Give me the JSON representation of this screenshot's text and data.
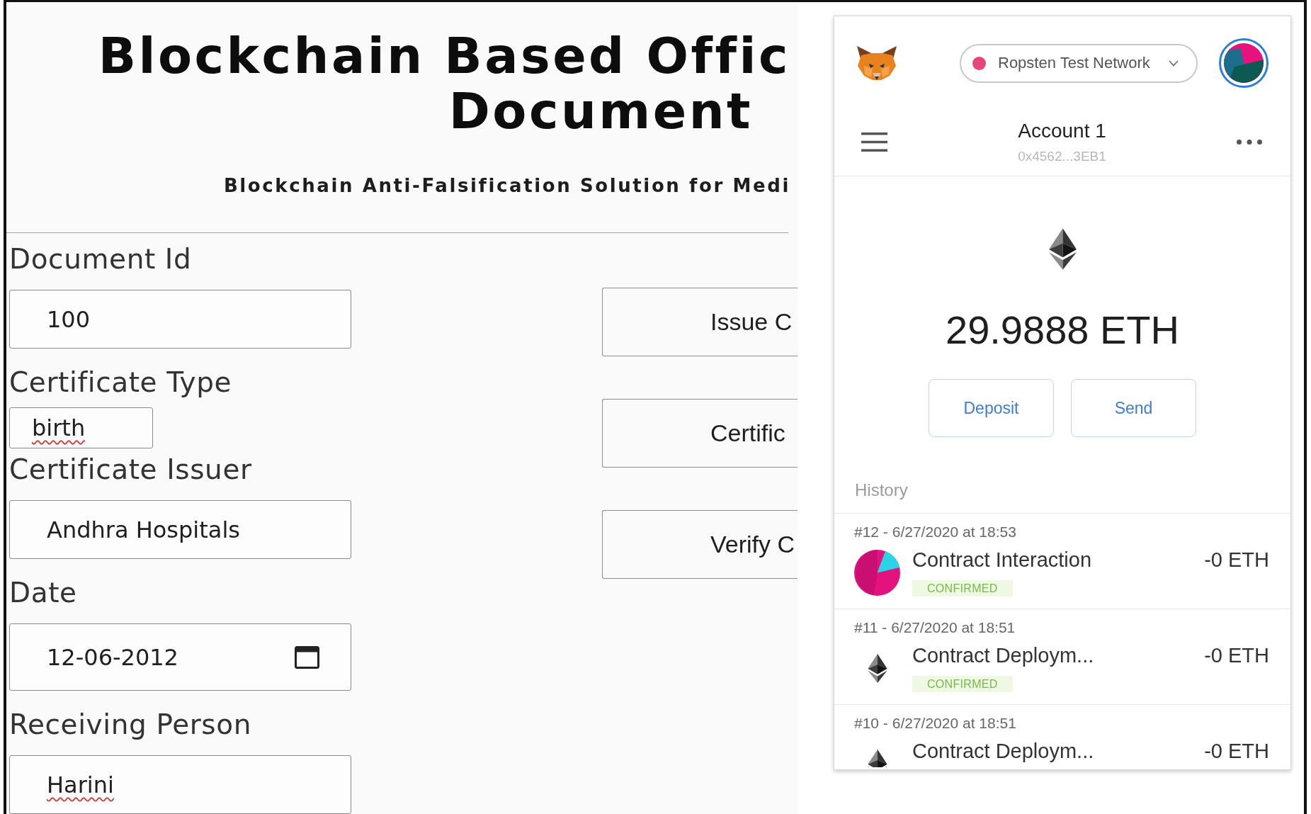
{
  "page": {
    "title_lines": [
      "Blockchain Based Offic",
      "Document"
    ],
    "subtitle": "Blockchain Anti-Falsification Solution for Medi"
  },
  "form": {
    "fields": [
      {
        "label": "Document Id",
        "value": "100",
        "kind": "text",
        "misspelled": false
      },
      {
        "label": "Certificate Type",
        "value": "birth",
        "kind": "short",
        "misspelled": true
      },
      {
        "label": "Certificate Issuer",
        "value": "Andhra Hospitals",
        "kind": "text",
        "misspelled": false
      },
      {
        "label": "Date",
        "value": "12-06-2012",
        "kind": "date",
        "misspelled": false
      },
      {
        "label": "Receiving Person",
        "value": "Harini",
        "kind": "text",
        "misspelled": true
      }
    ],
    "actions": [
      "Issue C",
      "Certific",
      "Verify C"
    ]
  },
  "wallet": {
    "network": "Ropsten Test Network",
    "account": {
      "name": "Account 1",
      "address": "0x4562...3EB1"
    },
    "balance": "29.9888 ETH",
    "actions": [
      "Deposit",
      "Send"
    ],
    "history": {
      "label": "History",
      "transactions": [
        {
          "meta": "#12 - 6/27/2020 at 18:53",
          "kind": "interaction",
          "title": "Contract Interaction",
          "amount": "-0 ETH",
          "status": "CONFIRMED"
        },
        {
          "meta": "#11 - 6/27/2020 at 18:51",
          "kind": "deploy",
          "title": "Contract Deploym...",
          "amount": "-0 ETH",
          "status": "CONFIRMED"
        },
        {
          "meta": "#10 - 6/27/2020 at 18:51",
          "kind": "deploy",
          "title": "Contract Deploym...",
          "amount": "-0 ETH"
        }
      ]
    }
  }
}
